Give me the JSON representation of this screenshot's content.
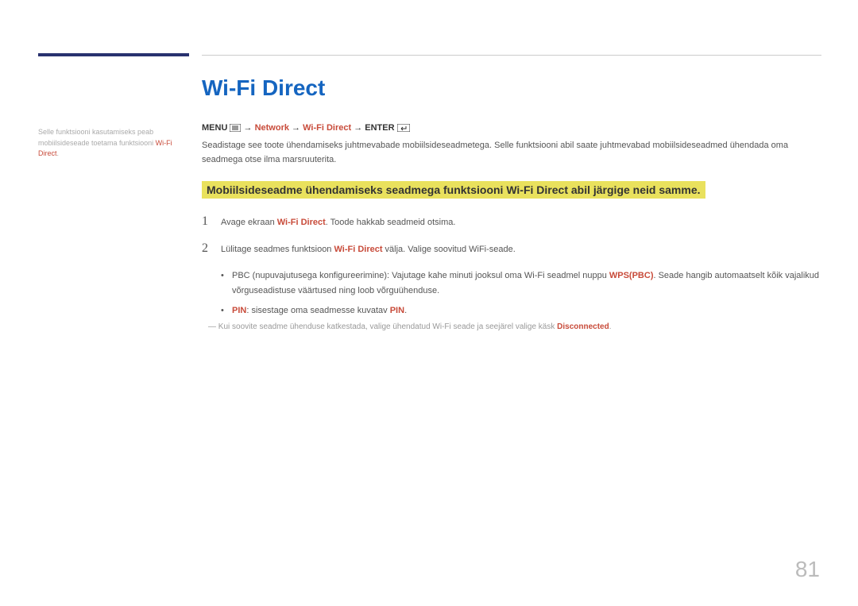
{
  "colors": {
    "accent": "#1565c0",
    "bar": "#29326f",
    "red": "#c84b3a",
    "highlight": "#e9e15d"
  },
  "sidebar": {
    "pre": "Selle funktsiooni kasutamiseks peab mobiilsideseade toetama funktsiooni ",
    "red": "Wi-Fi Direct",
    "post": "."
  },
  "title": "Wi-Fi Direct",
  "breadcrumb": {
    "menu": "MENU",
    "arrow": " → ",
    "network": "Network",
    "wifidirect": "Wi-Fi Direct",
    "enter": "ENTER"
  },
  "desc": "Seadistage see toote ühendamiseks juhtmevabade mobiilsideseadmetega. Selle funktsiooni abil saate juhtmevabad mobiilsideseadmed ühendada oma seadmega otse ilma marsruuterita.",
  "highlight": "Mobiilsideseadme ühendamiseks seadmega funktsiooni Wi-Fi Direct abil järgige neid samme.",
  "steps": {
    "s1": {
      "num": "1",
      "pre": "Avage ekraan ",
      "red": "Wi-Fi Direct",
      "post": ". Toode hakkab seadmeid otsima."
    },
    "s2": {
      "num": "2",
      "pre": "Lülitage seadmes funktsioon ",
      "red": "Wi-Fi Direct",
      "post": " välja. Valige soovitud WiFi-seade."
    }
  },
  "bullets": {
    "b1": {
      "pre": "PBC (nupuvajutusega konfigureerimine): Vajutage kahe minuti jooksul oma Wi-Fi seadmel nuppu ",
      "red": "WPS(PBC)",
      "post": ". Seade hangib automaatselt kõik vajalikud võrguseadistuse väärtused ning loob võrguühenduse."
    },
    "b2": {
      "label": "PIN",
      "mid": ": sisestage oma seadmesse kuvatav ",
      "red2": "PIN",
      "post": "."
    }
  },
  "note": {
    "pre": "Kui soovite seadme ühenduse katkestada, valige ühendatud Wi-Fi seade ja seejärel valige käsk ",
    "red": "Disconnected",
    "post": "."
  },
  "page": "81"
}
